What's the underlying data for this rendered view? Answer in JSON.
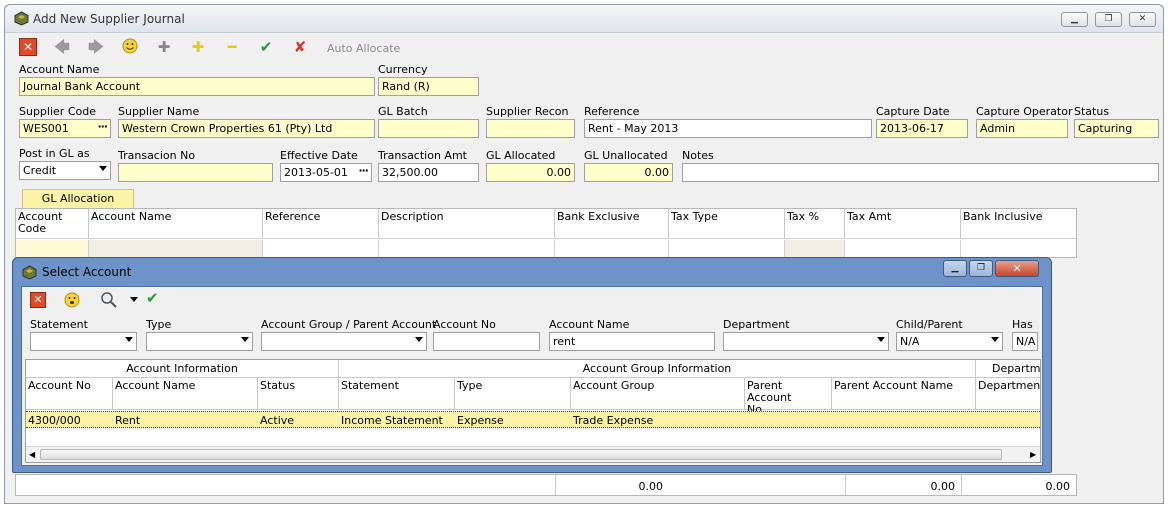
{
  "window": {
    "title": "Add New Supplier Journal",
    "min": "▁",
    "restore": "❐",
    "close": "✕"
  },
  "toolbar": {
    "auto_allocate": "Auto Allocate"
  },
  "form": {
    "account_name_label": "Account Name",
    "account_name": "Journal Bank Account",
    "currency_label": "Currency",
    "currency": "Rand (R)",
    "supplier_code_label": "Supplier Code",
    "supplier_code": "WES001",
    "supplier_name_label": "Supplier Name",
    "supplier_name": "Western Crown Properties 61 (Pty) Ltd",
    "gl_batch_label": "GL Batch",
    "gl_batch": "",
    "supplier_recon_label": "Supplier Recon",
    "supplier_recon": "",
    "reference_label": "Reference",
    "reference": "Rent - May 2013",
    "capture_date_label": "Capture Date",
    "capture_date": "2013-06-17",
    "capture_operator_label": "Capture Operator",
    "capture_operator": "Admin",
    "status_label": "Status",
    "status": "Capturing",
    "post_in_gl_label": "Post in GL as",
    "post_in_gl": "Credit",
    "transaction_no_label": "Transacion No",
    "transaction_no": "",
    "effective_date_label": "Effective Date",
    "effective_date": "2013-05-01",
    "transaction_amt_label": "Transaction Amt",
    "transaction_amt": "32,500.00",
    "gl_allocated_label": "GL Allocated",
    "gl_allocated": "0.00",
    "gl_unallocated_label": "GL Unallocated",
    "gl_unallocated": "0.00",
    "notes_label": "Notes",
    "notes": ""
  },
  "tab": {
    "label": "GL Allocation"
  },
  "alloc_grid": {
    "headers": [
      "Account\nCode",
      "Account Name",
      "Reference",
      "Description",
      "Bank Exclusive",
      "Tax Type",
      "Tax %",
      "Tax Amt",
      "Bank Inclusive"
    ]
  },
  "totals": {
    "bank_exclusive": "0.00",
    "tax_amt": "0.00",
    "bank_inclusive": "0.00"
  },
  "dialog": {
    "title": "Select Account",
    "filters": {
      "statement_label": "Statement",
      "statement": "",
      "type_label": "Type",
      "type": "",
      "group_label": "Account Group / Parent Account",
      "group": "",
      "account_no_label": "Account No",
      "account_no": "",
      "account_name_label": "Account Name",
      "account_name": "rent",
      "department_label": "Department",
      "department": "",
      "child_parent_label": "Child/Parent",
      "child_parent": "N/A",
      "has_label": "Has",
      "has": "N/A"
    },
    "groups": [
      "Account Information",
      "Account Group Information",
      "Department"
    ],
    "headers": [
      "Account No",
      "Account Name",
      "Status",
      "Statement",
      "Type",
      "Account Group",
      "Parent Account\nNo",
      "Parent Account Name",
      "Department"
    ],
    "row": [
      "4300/000",
      "Rent",
      "Active",
      "Income Statement",
      "Expense",
      "Trade Expense",
      "",
      "",
      ""
    ]
  }
}
